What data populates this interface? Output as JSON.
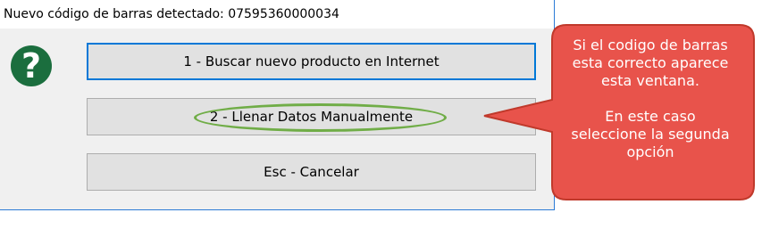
{
  "dialog": {
    "title": "Nuevo código de barras detectado: 07595360000034",
    "buttons": [
      {
        "label": "1 - Buscar nuevo producto en Internet"
      },
      {
        "label": "2 - Llenar Datos Manualmente"
      },
      {
        "label": "Esc - Cancelar"
      }
    ]
  },
  "icon": {
    "name": "question-icon",
    "color": "#1b6e3e"
  },
  "callout": {
    "fill_color": "#e8534b",
    "border_color": "#c0392b",
    "highlight_color": "#70ad47",
    "lines1": [
      "Si el codigo de barras",
      "esta correcto aparece",
      "esta ventana."
    ],
    "lines2": [
      "En este caso",
      "seleccione la segunda",
      "opción"
    ]
  }
}
